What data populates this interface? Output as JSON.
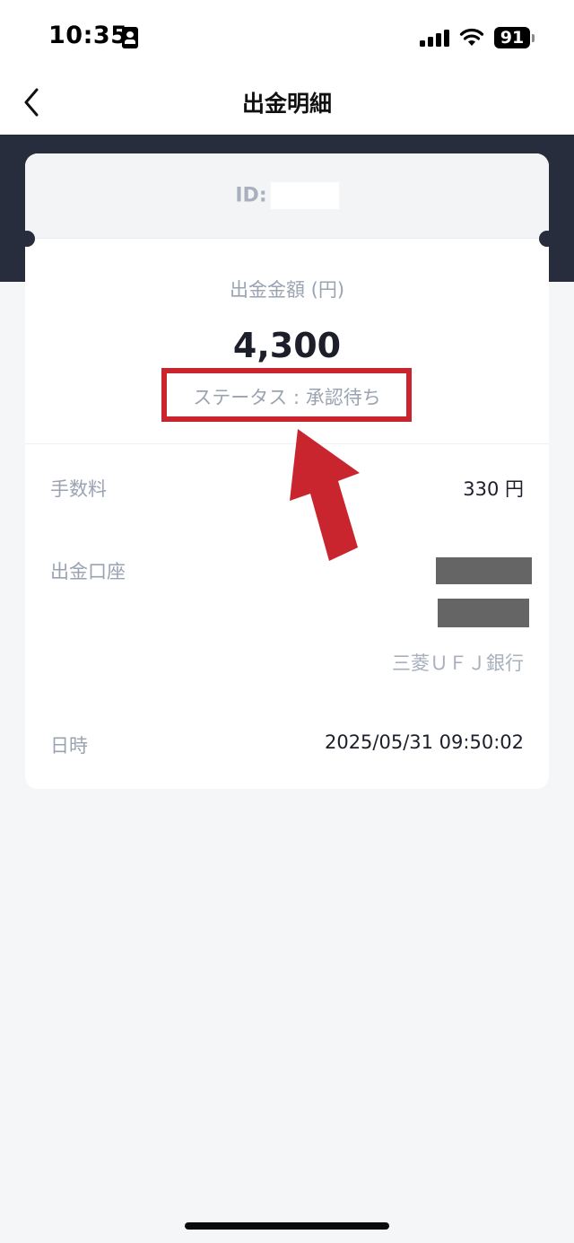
{
  "status_bar": {
    "time": "10:35",
    "battery": "91"
  },
  "nav": {
    "title": "出金明細"
  },
  "card": {
    "id_label": "ID:",
    "amount_label": "出金金額 (円)",
    "amount_value": "4,300",
    "status": "ステータス : 承認待ち",
    "rows": [
      {
        "label": "手数料",
        "value": "330 円"
      },
      {
        "label": "出金口座",
        "value": "三菱ＵＦＪ銀行"
      },
      {
        "label": "日時",
        "value": "2025/05/31 09:50:02"
      }
    ]
  },
  "colors": {
    "accent_red": "#c9252f",
    "header_band": "#282d3e",
    "muted_text": "#9aa3b2",
    "mask_gray": "#656565"
  },
  "icons": [
    "id-card-icon",
    "signal-icon",
    "wifi-icon",
    "battery-icon",
    "chevron-left-icon",
    "red-arrow-annotation"
  ]
}
